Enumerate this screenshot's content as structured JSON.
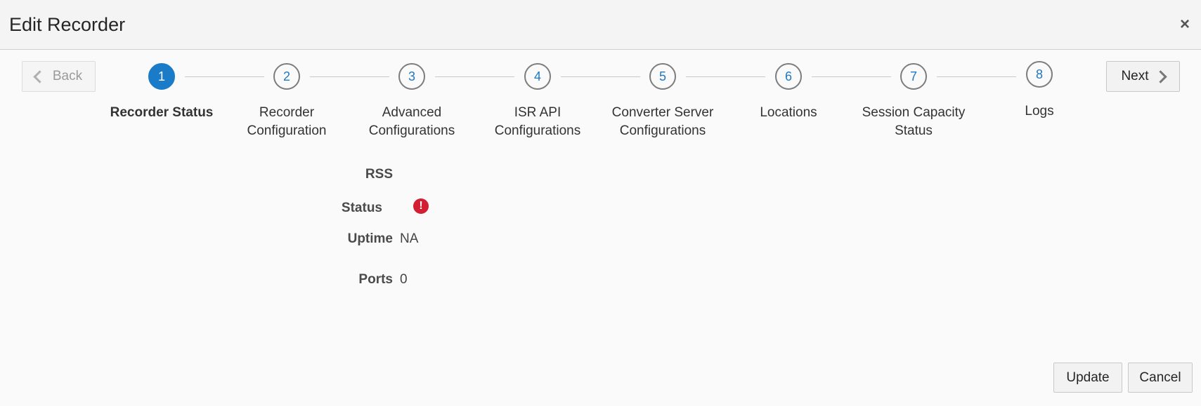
{
  "dialog": {
    "title": "Edit Recorder",
    "close_label": "×"
  },
  "nav": {
    "back_label": "Back",
    "next_label": "Next"
  },
  "steps": [
    {
      "number": "1",
      "label_line1": "Recorder Status",
      "label_line2": "",
      "active": true
    },
    {
      "number": "2",
      "label_line1": "Recorder",
      "label_line2": "Configuration",
      "active": false
    },
    {
      "number": "3",
      "label_line1": "Advanced",
      "label_line2": "Configurations",
      "active": false
    },
    {
      "number": "4",
      "label_line1": "ISR API",
      "label_line2": "Configurations",
      "active": false
    },
    {
      "number": "5",
      "label_line1": "Converter Server",
      "label_line2": "Configurations",
      "active": false
    },
    {
      "number": "6",
      "label_line1": "Locations",
      "label_line2": "",
      "active": false
    },
    {
      "number": "7",
      "label_line1": "Session Capacity",
      "label_line2": "Status",
      "active": false
    },
    {
      "number": "8",
      "label_line1": "Logs",
      "label_line2": "",
      "active": false
    }
  ],
  "status": {
    "section_label": "RSS",
    "status_label": "Status",
    "status_icon": "error-icon",
    "status_icon_glyph": "!",
    "status_color": "#d21f31",
    "uptime_label": "Uptime",
    "uptime_value": "NA",
    "ports_label": "Ports",
    "ports_value": "0"
  },
  "footer": {
    "update_label": "Update",
    "cancel_label": "Cancel"
  },
  "colors": {
    "accent": "#1a7bc9"
  }
}
